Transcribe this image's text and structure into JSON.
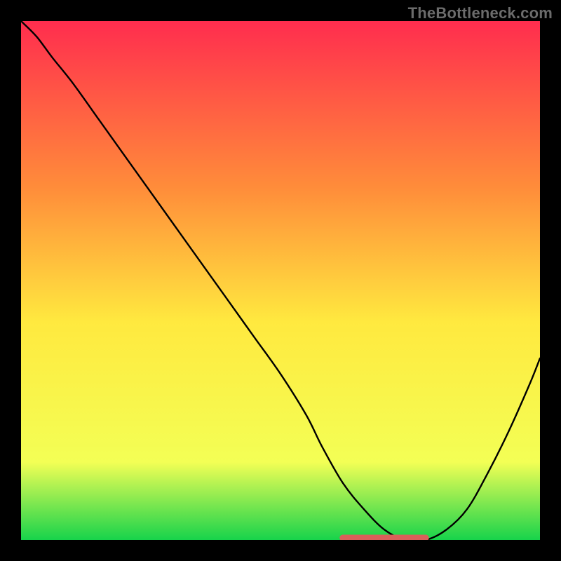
{
  "watermark": "TheBottleneck.com",
  "chart_data": {
    "type": "line",
    "title": "",
    "xlabel": "",
    "ylabel": "",
    "xlim": [
      0,
      100
    ],
    "ylim": [
      0,
      100
    ],
    "grid": false,
    "series": [
      {
        "name": "curve",
        "color": "#000000",
        "x": [
          0,
          3,
          6,
          10,
          15,
          20,
          25,
          30,
          35,
          40,
          45,
          50,
          55,
          58,
          62,
          66,
          70,
          74,
          78,
          82,
          86,
          90,
          94,
          98,
          100
        ],
        "y": [
          100,
          97,
          93,
          88,
          81,
          74,
          67,
          60,
          53,
          46,
          39,
          32,
          24,
          18,
          11,
          6,
          2,
          0,
          0,
          2,
          6,
          13,
          21,
          30,
          35
        ]
      },
      {
        "name": "optimal-band",
        "color": "#d9605a",
        "x": [
          62,
          78
        ],
        "y": [
          0,
          0
        ]
      }
    ],
    "background_gradient": {
      "top": "#ff2d4e",
      "mid_upper": "#ff8c3a",
      "mid": "#ffe93f",
      "mid_lower": "#f3ff55",
      "bottom": "#17d34b"
    }
  }
}
